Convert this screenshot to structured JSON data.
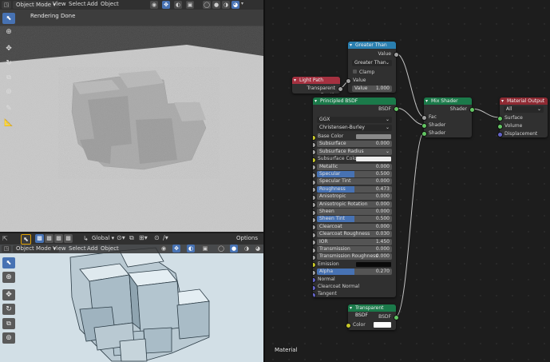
{
  "viewport_top": {
    "mode": "Object Mode",
    "menus": [
      "View",
      "Select",
      "Add",
      "Object"
    ],
    "status": "Rendering Done"
  },
  "viewport_bottom": {
    "mode": "Object Mode",
    "menus": [
      "View",
      "Select",
      "Add",
      "Object"
    ],
    "orientation": "Global",
    "options": "Options"
  },
  "node_editor": {
    "material_label": "Material",
    "greater_than": {
      "title": "Greater Than",
      "out": "Value",
      "op": "Greater Than",
      "clamp": "Clamp",
      "in_value": "Value",
      "field_label": "Value",
      "field_value": "1.000"
    },
    "light_path": {
      "title": "Light Path",
      "out": "Transparent Depth"
    },
    "principled": {
      "title": "Principled BSDF",
      "out": "BSDF",
      "distribution": "GGX",
      "subsurface_method": "Christensen-Burley",
      "rows": [
        {
          "label": "Base Color",
          "value": "",
          "type": "color",
          "color": "#8a8a8a"
        },
        {
          "label": "Subsurface",
          "value": "0.000",
          "type": "num"
        },
        {
          "label": "Subsurface Radius",
          "value": "",
          "type": "dd"
        },
        {
          "label": "Subsurface Color",
          "value": "",
          "type": "color",
          "color": "#eeeeee"
        },
        {
          "label": "Metallic",
          "value": "0.000",
          "type": "num"
        },
        {
          "label": "Specular",
          "value": "0.500",
          "type": "blue"
        },
        {
          "label": "Specular Tint",
          "value": "0.000",
          "type": "num"
        },
        {
          "label": "Roughness",
          "value": "0.473",
          "type": "blue"
        },
        {
          "label": "Anisotropic",
          "value": "0.000",
          "type": "num"
        },
        {
          "label": "Anisotropic Rotation",
          "value": "0.000",
          "type": "num"
        },
        {
          "label": "Sheen",
          "value": "0.000",
          "type": "num"
        },
        {
          "label": "Sheen Tint",
          "value": "0.500",
          "type": "blue"
        },
        {
          "label": "Clearcoat",
          "value": "0.000",
          "type": "num"
        },
        {
          "label": "Clearcoat Roughness",
          "value": "0.030",
          "type": "num"
        },
        {
          "label": "IOR",
          "value": "1.450",
          "type": "num"
        },
        {
          "label": "Transmission",
          "value": "0.000",
          "type": "num"
        },
        {
          "label": "Transmission Roughness",
          "value": "0.000",
          "type": "num"
        },
        {
          "label": "Emission",
          "value": "",
          "type": "color",
          "color": "#0a0a0a"
        },
        {
          "label": "Alpha",
          "value": "0.270",
          "type": "blue"
        },
        {
          "label": "Normal",
          "value": "",
          "type": "plain"
        },
        {
          "label": "Clearcoat Normal",
          "value": "",
          "type": "plain"
        },
        {
          "label": "Tangent",
          "value": "",
          "type": "plain"
        }
      ]
    },
    "mix_shader": {
      "title": "Mix Shader",
      "out": "Shader",
      "in1": "Fac",
      "in2": "Shader",
      "in3": "Shader"
    },
    "material_output": {
      "title": "Material Output",
      "target": "All",
      "in1": "Surface",
      "in2": "Volume",
      "in3": "Displacement"
    },
    "transparent": {
      "title": "Transparent BSDF",
      "out": "BSDF",
      "in_color": "Color"
    }
  },
  "colors": {
    "accent": "#4772b3",
    "shader_header": "#1b7a4a",
    "converter_header": "#2a7fb0",
    "input_header": "#a53140",
    "output_header": "#8f2a33"
  }
}
